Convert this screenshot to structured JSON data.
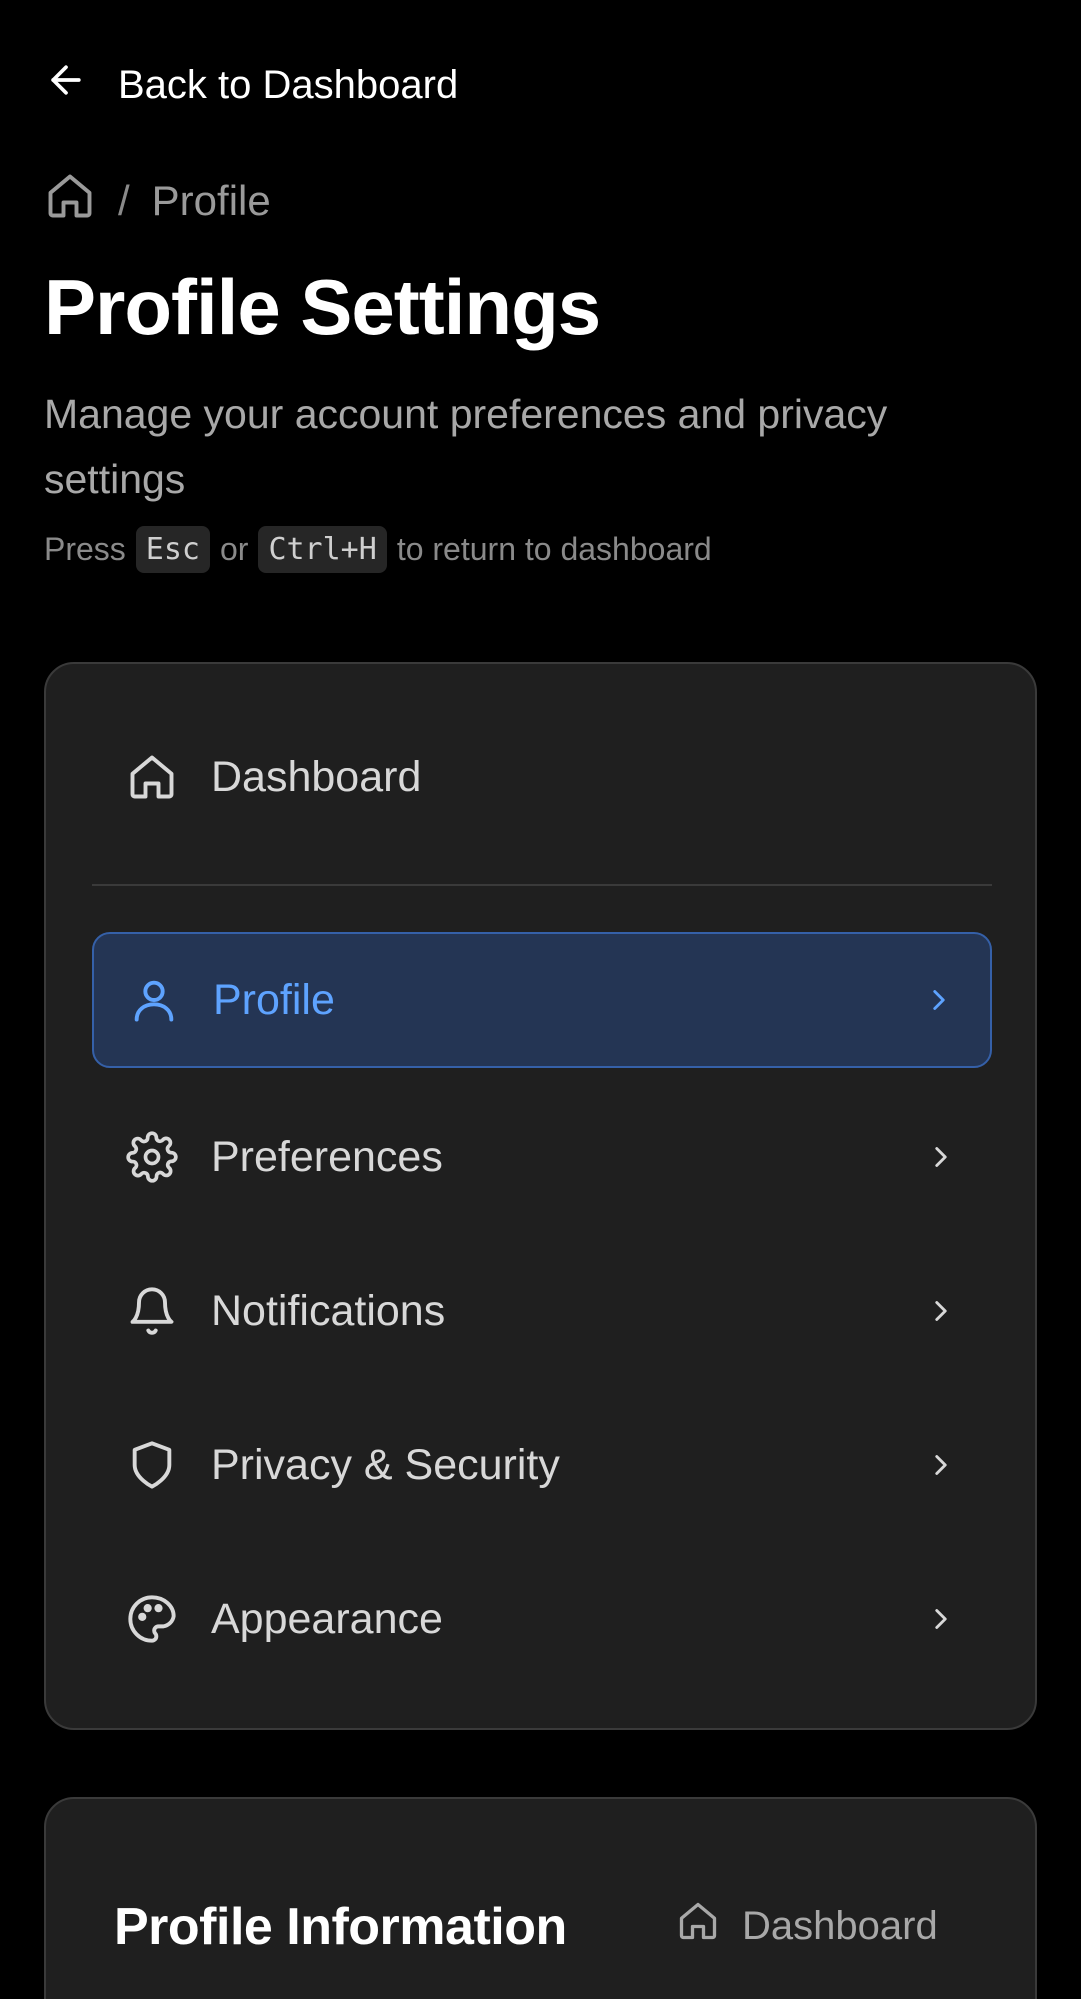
{
  "header": {
    "back_label": "Back to Dashboard",
    "breadcrumb": {
      "current": "Profile",
      "separator": "/"
    },
    "title": "Profile Settings",
    "subtitle": "Manage your account preferences and privacy settings",
    "hint": {
      "press": "Press",
      "key1": "Esc",
      "or": "or",
      "key2": "Ctrl+H",
      "suffix": "to return to dashboard"
    }
  },
  "nav": {
    "dashboard": {
      "label": "Dashboard",
      "icon": "home-icon"
    },
    "items": [
      {
        "label": "Profile",
        "icon": "user-icon",
        "active": true
      },
      {
        "label": "Preferences",
        "icon": "gear-icon",
        "active": false
      },
      {
        "label": "Notifications",
        "icon": "bell-icon",
        "active": false
      },
      {
        "label": "Privacy & Security",
        "icon": "shield-icon",
        "active": false
      },
      {
        "label": "Appearance",
        "icon": "palette-icon",
        "active": false
      }
    ]
  },
  "info_card": {
    "title": "Profile Information",
    "dashboard_link": "Dashboard"
  },
  "colors": {
    "background": "#000000",
    "card": "#1f1f1f",
    "accent": "#5ea3ff",
    "active_bg": "#243554"
  }
}
